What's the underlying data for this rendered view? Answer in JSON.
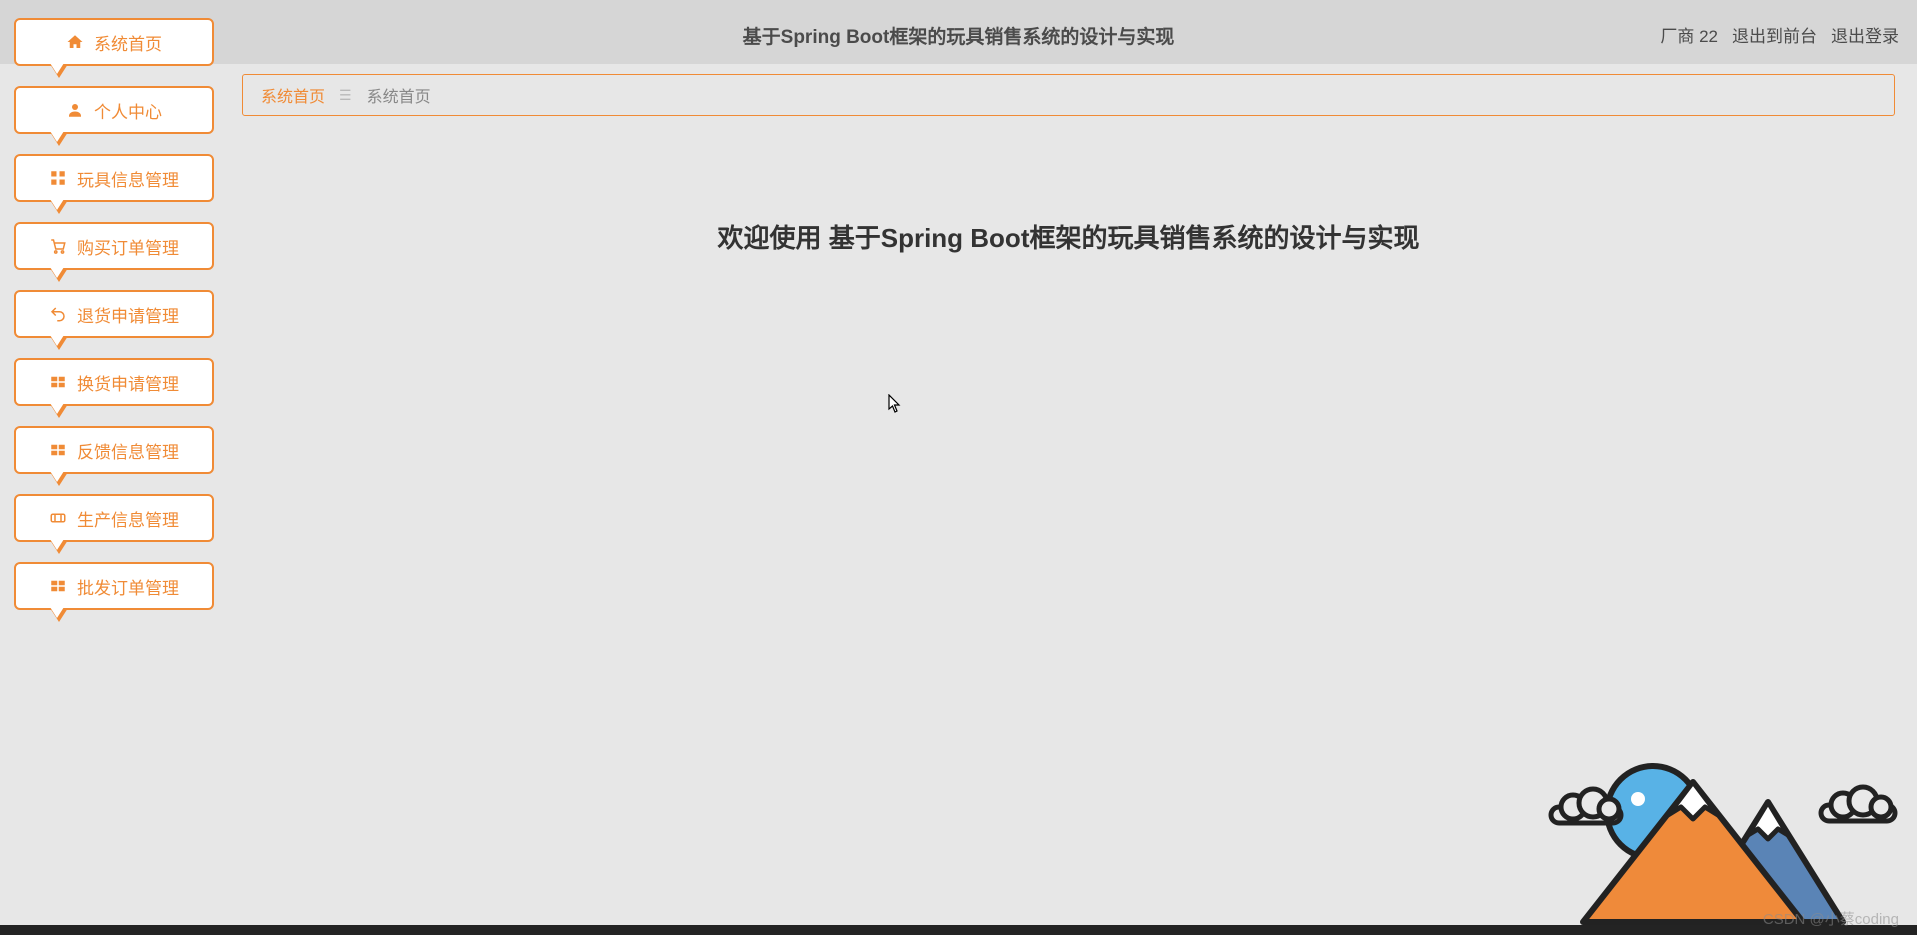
{
  "colors": {
    "accent": "#f08b36"
  },
  "header": {
    "title": "基于Spring Boot框架的玩具销售系统的设计与实现",
    "user_label": "厂商 22",
    "to_front": "退出到前台",
    "logout": "退出登录"
  },
  "sidebar": {
    "items": [
      {
        "icon": "home-icon",
        "label": "系统首页"
      },
      {
        "icon": "user-icon",
        "label": "个人中心"
      },
      {
        "icon": "grid-icon",
        "label": "玩具信息管理"
      },
      {
        "icon": "cart-icon",
        "label": "购买订单管理"
      },
      {
        "icon": "return-icon",
        "label": "退货申请管理"
      },
      {
        "icon": "exchange-icon",
        "label": "换货申请管理"
      },
      {
        "icon": "feedback-icon",
        "label": "反馈信息管理"
      },
      {
        "icon": "ticket-icon",
        "label": "生产信息管理"
      },
      {
        "icon": "wholesale-icon",
        "label": "批发订单管理"
      }
    ]
  },
  "breadcrumb": {
    "root": "系统首页",
    "separator": "☰",
    "current": "系统首页"
  },
  "main": {
    "welcome": "欢迎使用 基于Spring Boot框架的玩具销售系统的设计与实现"
  },
  "watermark": "CSDN @小蔡coding"
}
